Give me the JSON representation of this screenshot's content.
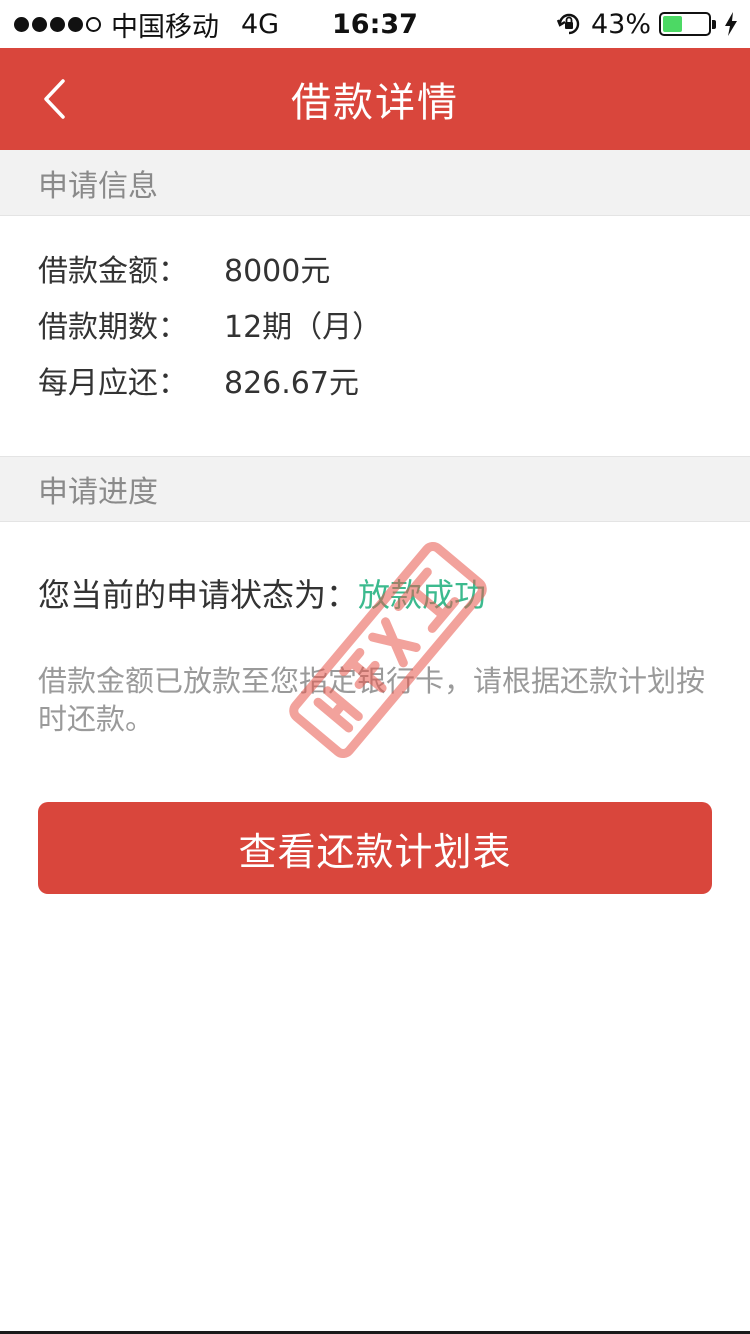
{
  "status_bar": {
    "carrier": "中国移动",
    "network": "4G",
    "time": "16:37",
    "battery": "43%",
    "battery_level": 0.43,
    "icons": [
      "signal-dots-icon",
      "rotation-lock-icon",
      "battery-icon",
      "charging-bolt-icon"
    ]
  },
  "nav": {
    "title": "借款详情",
    "back_icon": "chevron-left-icon"
  },
  "application_info": {
    "header": "申请信息",
    "rows": [
      {
        "label": "借款金额：",
        "value": "8000元"
      },
      {
        "label": "借款期数：",
        "value": "12期（月）"
      },
      {
        "label": "每月应还：",
        "value": "826.67元"
      }
    ]
  },
  "application_progress": {
    "header": "申请进度",
    "status_label": "您当前的申请状态为：",
    "status_value": "放款成功",
    "notice": "借款金额已放款至您指定银行卡，请根据还款计划按时还款。"
  },
  "actions": {
    "view_schedule": "查看还款计划表"
  },
  "colors": {
    "primary": "#d9463c",
    "success": "#3cba8e",
    "section_bg": "#f2f2f2",
    "muted_text": "#9a9a9a"
  }
}
